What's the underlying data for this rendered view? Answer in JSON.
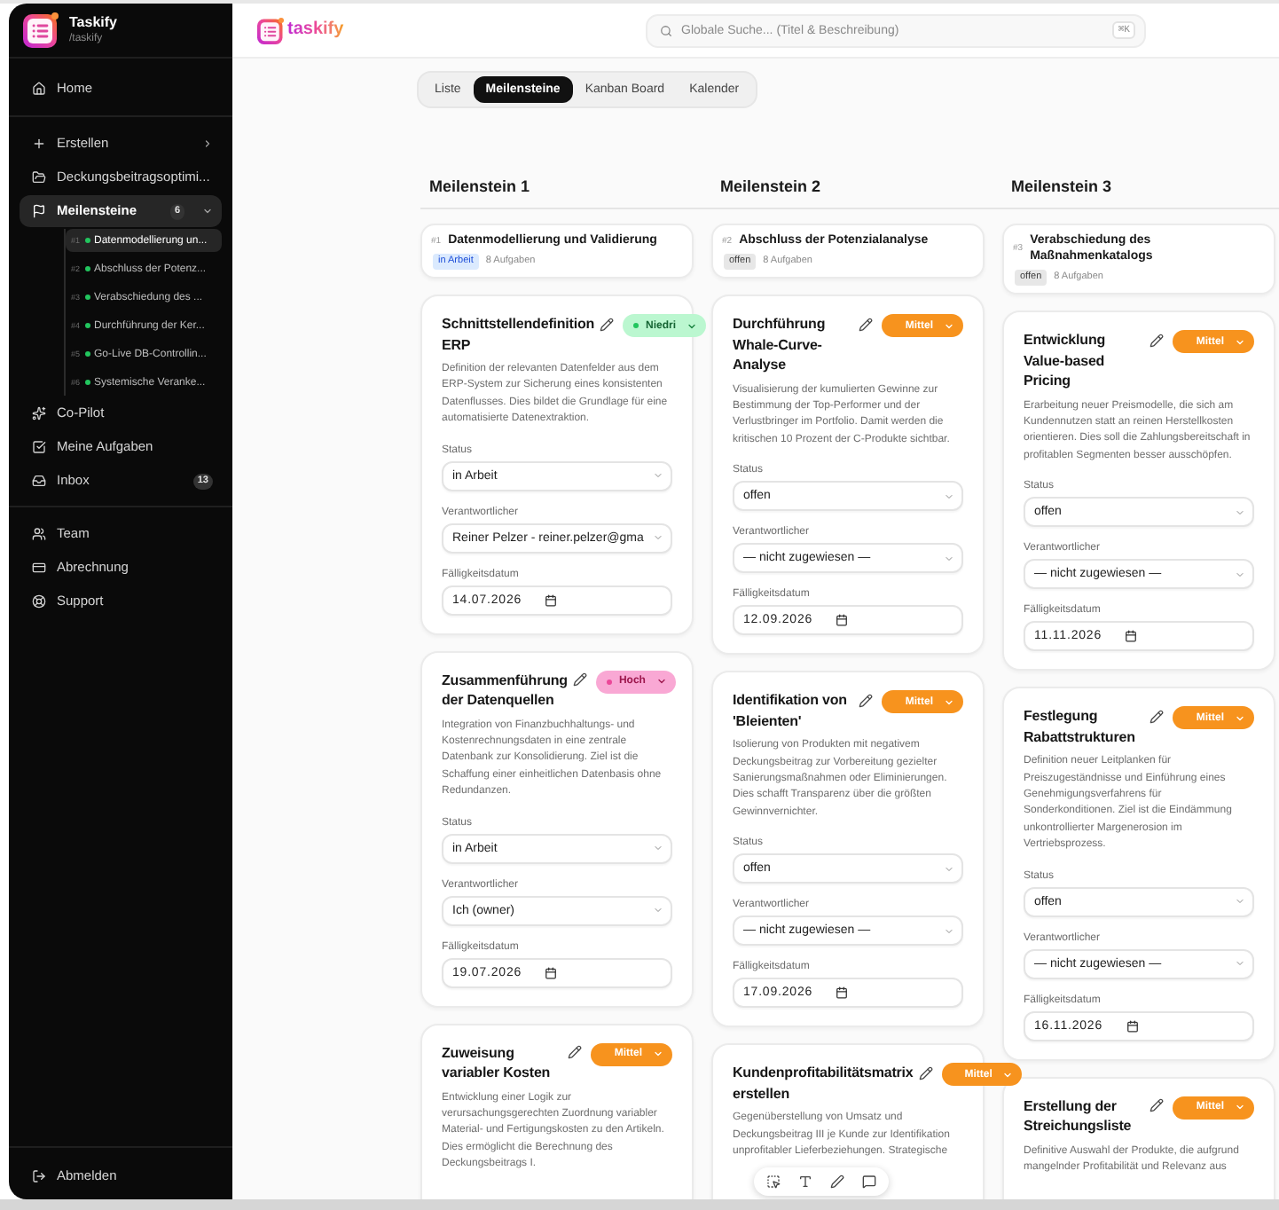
{
  "sidebar": {
    "brand": {
      "name": "Taskify",
      "handle": "/taskify"
    },
    "sections": [
      {
        "items": [
          {
            "label": "Home",
            "kind": "link",
            "selected": false
          }
        ]
      },
      {
        "items": [
          {
            "label": "Erstellen",
            "kind": "menu",
            "selected": false,
            "expanded": false
          },
          {
            "label": "Deckungsbeitragsoptimi...",
            "kind": "link",
            "selected": false
          },
          {
            "label": "Meilensteine",
            "kind": "menu",
            "selected": true,
            "expanded": true,
            "badge": "6",
            "children": [
              {
                "number": "#1",
                "label": "Datenmodellierung un...",
                "color": "#22c55e",
                "selected": true
              },
              {
                "number": "#2",
                "label": "Abschluss der Potenz...",
                "color": "#22c55e",
                "selected": false
              },
              {
                "number": "#3",
                "label": "Verabschiedung des ...",
                "color": "#22c55e",
                "selected": false
              },
              {
                "number": "#4",
                "label": "Durchführung der Ker...",
                "color": "#22c55e",
                "selected": false
              },
              {
                "number": "#5",
                "label": "Go-Live DB-Controllin...",
                "color": "#22c55e",
                "selected": false
              },
              {
                "number": "#6",
                "label": "Systemische Veranke...",
                "color": "#22c55e",
                "selected": false
              }
            ]
          },
          {
            "label": "Co-Pilot",
            "kind": "link",
            "selected": false
          },
          {
            "label": "Meine Aufgaben",
            "kind": "link",
            "selected": false
          },
          {
            "label": "Inbox",
            "kind": "link",
            "selected": false,
            "badge": "13"
          }
        ]
      },
      {
        "items": [
          {
            "label": "Team",
            "kind": "link",
            "selected": false
          },
          {
            "label": "Abrechnung",
            "kind": "link",
            "selected": false
          },
          {
            "label": "Support",
            "kind": "link",
            "selected": false
          }
        ]
      }
    ],
    "footer": {
      "label": "Abmelden"
    }
  },
  "header": {
    "logo_text": "taskify",
    "search": {
      "placeholder": "Globale Suche... (Titel & Beschreibung)",
      "shortcut": "⌘K"
    }
  },
  "tabs": [
    {
      "label": "Liste",
      "selected": false
    },
    {
      "label": "Meilensteine",
      "selected": true
    },
    {
      "label": "Kanban Board",
      "selected": false
    },
    {
      "label": "Kalender",
      "selected": false
    }
  ],
  "board": {
    "columns": [
      {
        "title": "Meilenstein 1",
        "milestone": {
          "number": "#1",
          "title": "Datenmodellierung und Validierung",
          "status": {
            "label": "in Arbeit",
            "kind": "in_progress"
          },
          "task_count": "8 Aufgaben"
        },
        "tasks": [
          {
            "title": "Schnittstellendefinition ERP",
            "priority": {
              "label": "Niedri",
              "kind": "low"
            },
            "description": "Definition der relevanten Datenfelder aus dem ERP-System zur Sicherung eines konsistenten Datenflusses. Dies bildet die Grundlage für eine automatisierte Datenextraktion.",
            "fields": [
              {
                "label": "Status",
                "kind": "select",
                "value": "in Arbeit"
              },
              {
                "label": "Verantwortlicher",
                "kind": "select",
                "value": "Reiner Pelzer - reiner.pelzer@gma"
              },
              {
                "label": "Fälligkeitsdatum",
                "kind": "date",
                "value": "14.07.2026"
              }
            ]
          },
          {
            "title": "Zusammenführung der Datenquellen",
            "priority": {
              "label": "Hoch",
              "kind": "high"
            },
            "description": "Integration von Finanzbuchhaltungs- und Kostenrechnungsdaten in eine zentrale Datenbank zur Konsolidierung. Ziel ist die Schaffung einer einheitlichen Datenbasis ohne Redundanzen.",
            "fields": [
              {
                "label": "Status",
                "kind": "select",
                "value": "in Arbeit"
              },
              {
                "label": "Verantwortlicher",
                "kind": "select",
                "value": "Ich (owner)"
              },
              {
                "label": "Fälligkeitsdatum",
                "kind": "date",
                "value": "19.07.2026"
              }
            ]
          },
          {
            "title": "Zuweisung variabler Kosten",
            "priority": {
              "label": "Mittel",
              "kind": "medium"
            },
            "description": "Entwicklung einer Logik zur verursachungsgerechten Zuordnung variabler Material- und Fertigungskosten zu den Artikeln. Dies ermöglicht die Berechnung des Deckungsbeitrags I."
          }
        ]
      },
      {
        "title": "Meilenstein 2",
        "milestone": {
          "number": "#2",
          "title": "Abschluss der Potenzialanalyse",
          "status": {
            "label": "offen",
            "kind": "open"
          },
          "task_count": "8 Aufgaben"
        },
        "tasks": [
          {
            "title": "Durchführung Whale-Curve-Analyse",
            "priority": {
              "label": "Mittel",
              "kind": "medium"
            },
            "description": "Visualisierung der kumulierten Gewinne zur Bestimmung der Top-Performer und der Verlustbringer im Portfolio. Damit werden die kritischen 10 Prozent der C-Produkte sichtbar.",
            "fields": [
              {
                "label": "Status",
                "kind": "select",
                "value": "offen"
              },
              {
                "label": "Verantwortlicher",
                "kind": "select",
                "value": "— nicht zugewiesen —"
              },
              {
                "label": "Fälligkeitsdatum",
                "kind": "date",
                "value": "12.09.2026"
              }
            ]
          },
          {
            "title": "Identifikation von 'Bleienten'",
            "priority": {
              "label": "Mittel",
              "kind": "medium"
            },
            "description": "Isolierung von Produkten mit negativem Deckungsbeitrag zur Vorbereitung gezielter Sanierungsmaßnahmen oder Eliminierungen. Dies schafft Transparenz über die größten Gewinnvernichter.",
            "fields": [
              {
                "label": "Status",
                "kind": "select",
                "value": "offen"
              },
              {
                "label": "Verantwortlicher",
                "kind": "select",
                "value": "— nicht zugewiesen —"
              },
              {
                "label": "Fälligkeitsdatum",
                "kind": "date",
                "value": "17.09.2026"
              }
            ]
          },
          {
            "title": "Kundenprofitabilitätsmatrix erstellen",
            "priority": {
              "label": "Mittel",
              "kind": "medium"
            },
            "description": "Gegenüberstellung von Umsatz und Deckungsbeitrag III je Kunde zur Identifikation unprofitabler Lieferbeziehungen. Strategische"
          }
        ]
      },
      {
        "title": "Meilenstein 3",
        "milestone": {
          "number": "#3",
          "title": "Verabschiedung des Maßnahmenkatalogs",
          "status": {
            "label": "offen",
            "kind": "open"
          },
          "task_count": "8 Aufgaben"
        },
        "tasks": [
          {
            "title": "Entwicklung Value-based Pricing",
            "priority": {
              "label": "Mittel",
              "kind": "medium"
            },
            "description": "Erarbeitung neuer Preismodelle, die sich am Kundennutzen statt an reinen Herstellkosten orientieren. Dies soll die Zahlungsbereitschaft in profitablen Segmenten besser ausschöpfen.",
            "fields": [
              {
                "label": "Status",
                "kind": "select",
                "value": "offen"
              },
              {
                "label": "Verantwortlicher",
                "kind": "select",
                "value": "— nicht zugewiesen —"
              },
              {
                "label": "Fälligkeitsdatum",
                "kind": "date",
                "value": "11.11.2026"
              }
            ]
          },
          {
            "title": "Festlegung Rabattstrukturen",
            "priority": {
              "label": "Mittel",
              "kind": "medium"
            },
            "description": "Definition neuer Leitplanken für Preiszugeständnisse und Einführung eines Genehmigungsverfahrens für Sonderkonditionen. Ziel ist die Eindämmung unkontrollierter Margenerosion im Vertriebsprozess.",
            "fields": [
              {
                "label": "Status",
                "kind": "select",
                "value": "offen"
              },
              {
                "label": "Verantwortlicher",
                "kind": "select",
                "value": "— nicht zugewiesen —"
              },
              {
                "label": "Fälligkeitsdatum",
                "kind": "date",
                "value": "16.11.2026"
              }
            ]
          },
          {
            "title": "Erstellung der Streichungsliste",
            "priority": {
              "label": "Mittel",
              "kind": "medium"
            },
            "description": "Definitive Auswahl der Produkte, die aufgrund mangelnder Profitabilität und Relevanz aus"
          }
        ]
      }
    ]
  }
}
